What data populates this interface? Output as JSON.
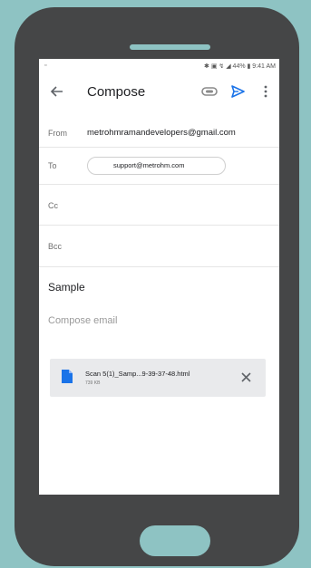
{
  "status_bar": {
    "left_icon": "image-icon",
    "right_text": "✱ ▣ ↯ ◢ 44% ▮ 9:41 AM"
  },
  "appbar": {
    "title": "Compose",
    "back_icon": "arrow-back-icon",
    "attach_icon": "paperclip-icon",
    "send_icon": "send-icon",
    "more_icon": "more-vert-icon",
    "accent_color": "#1a73e8"
  },
  "fields": {
    "from_label": "From",
    "from_value": "metrohmramandevelopers@gmail.com",
    "to_label": "To",
    "to_chip": "support@metrohm.com",
    "cc_label": "Cc",
    "bcc_label": "Bcc"
  },
  "subject": "Sample",
  "body_placeholder": "Compose email",
  "attachment": {
    "name": "Scan 5(1)_Samp...9-39-37-48.html",
    "size": "739 KB",
    "icon": "file-icon",
    "icon_color": "#1a73e8",
    "remove_icon": "close-icon"
  }
}
